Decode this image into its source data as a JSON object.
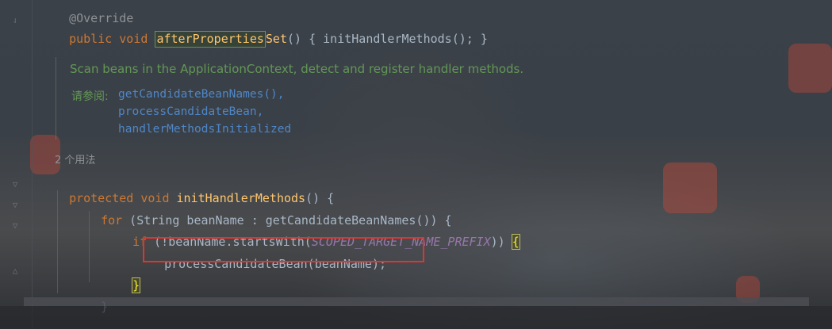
{
  "editor": {
    "line_override": "@Override",
    "afterprops": {
      "kw1": "public void ",
      "name_highlight": "afterProperties",
      "name_rest": "Set",
      "rest": "() { initHandlerMethods(); }"
    },
    "doc": {
      "text": "Scan beans in the ApplicationContext, detect and register handler methods.",
      "see_label": "请参阅:",
      "links": [
        "getCandidateBeanNames(),",
        "processCandidateBean,",
        "handlerMethodsInitialized"
      ]
    },
    "usages": "2 个用法",
    "method_decl": {
      "kw": "protected void ",
      "name": "initHandlerMethods",
      "rest": "() {"
    },
    "for_line": {
      "kw": "for",
      "rest": " (String beanName : getCandidateBeanNames()) {"
    },
    "if_line": {
      "kw": "if",
      "pre": " (!beanName.startsWith(",
      "const": "SCOPED_TARGET_NAME_PREFIX",
      "post": ")) ",
      "brace": "{"
    },
    "call_line": "processCandidateBean(beanName);",
    "close_brace_inner": "}",
    "close_brace_outer": "}"
  },
  "colors": {
    "keyword": "#cc7832",
    "method": "#ffc66d",
    "constant": "#9876aa",
    "doc": "#629755",
    "link": "#4f86c6",
    "highlight_box": "#e0342f"
  }
}
